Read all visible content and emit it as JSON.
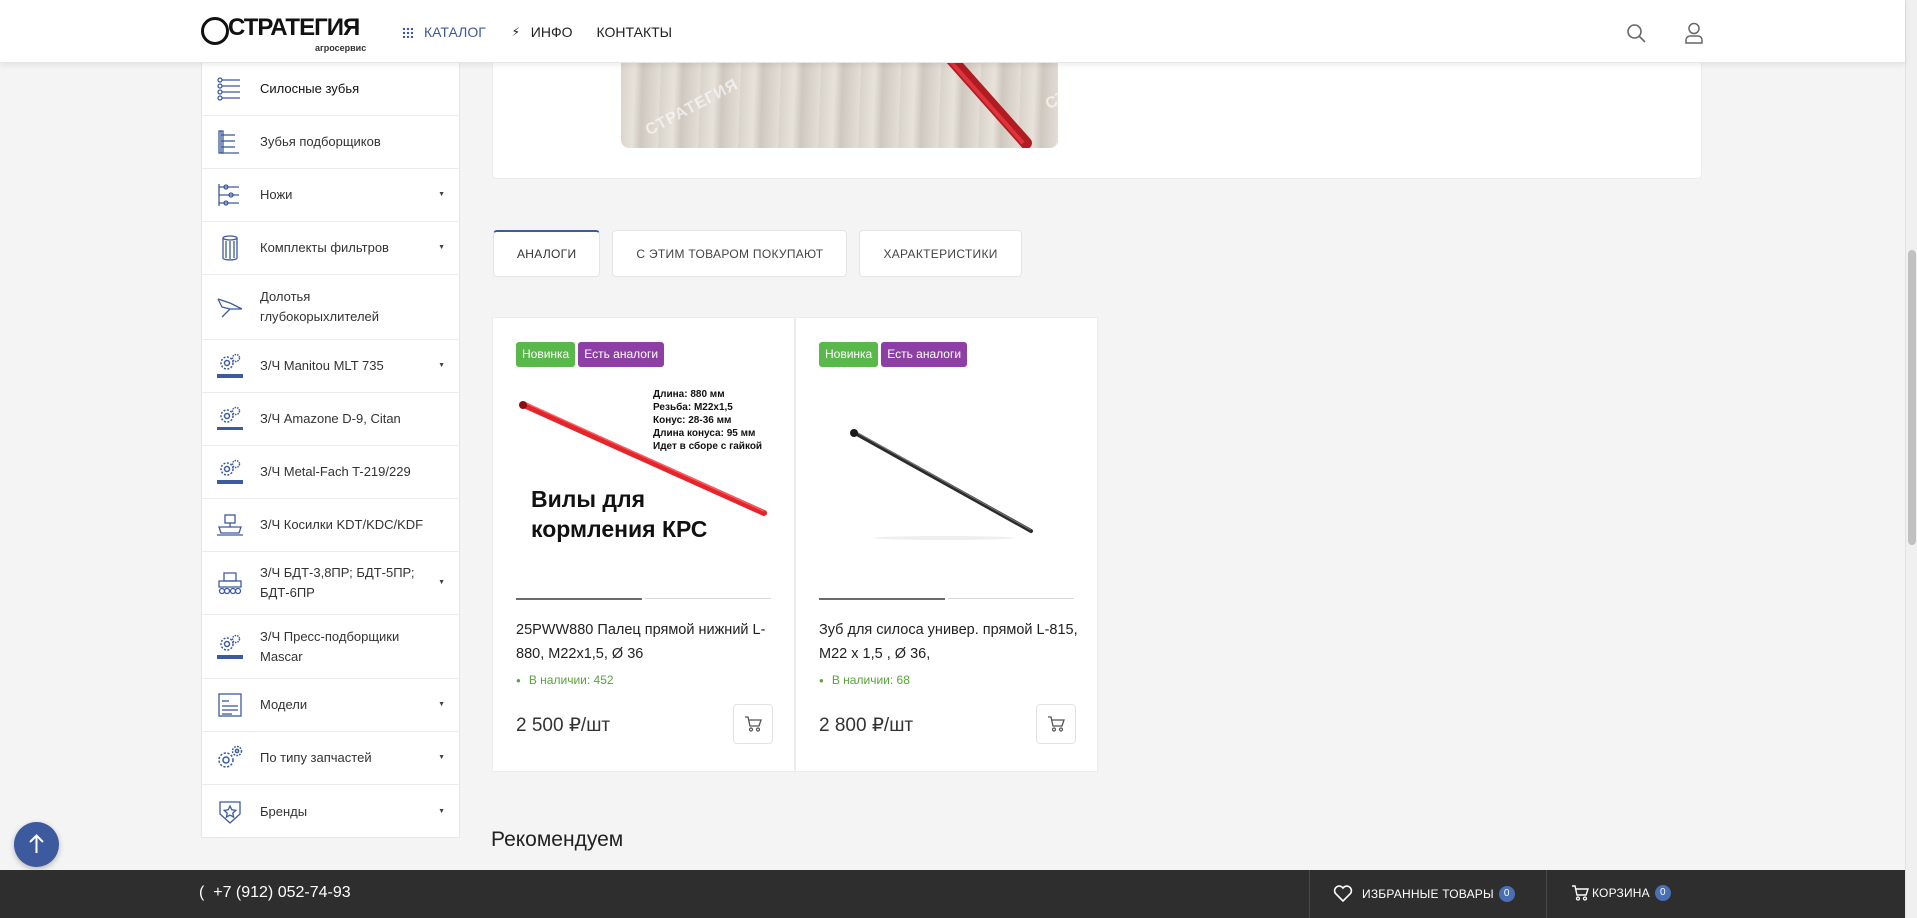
{
  "header": {
    "logo_name": "СТРАТЕГИЯ",
    "logo_sub": "агросервис",
    "nav": [
      {
        "label": "КАТАЛОГ",
        "icon": "grid-icon"
      },
      {
        "label": "ИНФО",
        "icon": "lightning-icon"
      },
      {
        "label": "КОНТАКТЫ"
      }
    ]
  },
  "sidebar": {
    "items": [
      {
        "label": "Силосные зубья",
        "icon": "silage-tines-icon",
        "has_submenu": false
      },
      {
        "label": "Зубья подборщиков",
        "icon": "pickup-tines-icon",
        "has_submenu": false
      },
      {
        "label": "Ножи",
        "icon": "knives-icon",
        "has_submenu": true
      },
      {
        "label": "Комплекты фильтров",
        "icon": "filter-icon",
        "has_submenu": true
      },
      {
        "label": "Долотья глубокорыхлителей",
        "icon": "subsoiler-chisel-icon",
        "has_submenu": false
      },
      {
        "label": "З/Ч Manitou MLT 735",
        "icon": "manitou-gears-icon",
        "has_submenu": true
      },
      {
        "label": "З/Ч Amazone D-9, Citan",
        "icon": "amazone-gears-icon",
        "has_submenu": false
      },
      {
        "label": "З/Ч Metal-Fach T-219/229",
        "icon": "metal-fach-gears-icon",
        "has_submenu": false
      },
      {
        "label": "З/Ч Косилки KDT/KDC/KDF",
        "icon": "mower-icon",
        "has_submenu": false
      },
      {
        "label": "З/Ч БДТ-3,8ПР; БДТ-5ПР; БДТ-6ПР",
        "icon": "disc-harrow-icon",
        "has_submenu": true
      },
      {
        "label": "З/Ч Пресс-подборщики Mascar",
        "icon": "mascar-gears-icon",
        "has_submenu": false
      },
      {
        "label": "Модели",
        "icon": "models-icon",
        "has_submenu": true
      },
      {
        "label": "По типу запчастей",
        "icon": "gears-icon",
        "has_submenu": true
      },
      {
        "label": "Бренды",
        "icon": "badge-star-icon",
        "has_submenu": true
      }
    ]
  },
  "product": {
    "watermark": "СТРАТЕГИЯ"
  },
  "tabs": [
    {
      "label": "АНАЛОГИ",
      "active": true
    },
    {
      "label": "С ЭТИМ ТОВАРОМ ПОКУПАЮТ",
      "active": false
    },
    {
      "label": "ХАРАКТЕРИСТИКИ",
      "active": false
    }
  ],
  "analogs": [
    {
      "badges": [
        "Новинка",
        "Есть аналоги"
      ],
      "title": "25PWW880 Палец прямой нижний L-880, M22x1,5, Ø 36",
      "stock": "В наличии: 452",
      "price": "2 500 ₽/шт",
      "image_spec_lines": [
        "Длина: 880 мм",
        "Резьба: M22x1,5",
        "Конус: 28-36 мм",
        "Длина конуса: 95 мм",
        "Идет в сборе с гайкой"
      ],
      "image_caption_lines": [
        "Вилы для",
        "кормления КРС"
      ],
      "tine_color": "#e3262b"
    },
    {
      "badges": [
        "Новинка",
        "Есть аналоги"
      ],
      "title": "Зуб для силоса универ. прямой L-815, M22 x 1,5 , Ø 36,",
      "stock": "В наличии: 68",
      "price": "2 800 ₽/шт",
      "tine_color": "#2b2b2b"
    }
  ],
  "recommend_title": "Рекомендуем",
  "bottom": {
    "phone_prefix": "(",
    "phone": "+7 (912) 052-74-93",
    "favorites_label": "ИЗБРАННЫЕ ТОВАРЫ",
    "favorites_count": "0",
    "cart_label": "КОРЗИНА",
    "cart_count": "0"
  },
  "colors": {
    "accent": "#3d5a9e",
    "badge_new": "#58b94a",
    "badge_analog": "#8e3fa5",
    "stock_green": "#58a33c",
    "bottom_bar": "#2e2e2e"
  }
}
